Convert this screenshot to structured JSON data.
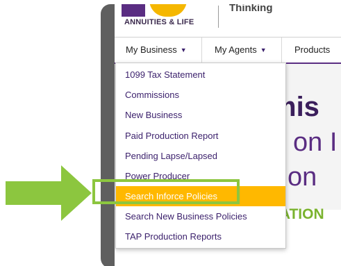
{
  "header": {
    "logo_text": "ANNUITIES & LIFE",
    "tagline": "Thinking"
  },
  "nav": {
    "items": [
      {
        "label": "My Business",
        "caret": "▼"
      },
      {
        "label": "My Agents",
        "caret": "▼"
      },
      {
        "label": "Products",
        "caret": ""
      }
    ]
  },
  "dropdown": {
    "items": [
      {
        "label": "1099 Tax Statement"
      },
      {
        "label": "Commissions"
      },
      {
        "label": "New Business"
      },
      {
        "label": "Paid Production Report"
      },
      {
        "label": "Pending Lapse/Lapsed"
      },
      {
        "label": "Power Producer"
      },
      {
        "label": "Search Inforce Policies",
        "active": true
      },
      {
        "label": "Search New Business Policies"
      },
      {
        "label": "TAP Production Reports"
      }
    ]
  },
  "hero": {
    "line1": "mis",
    "line2": "on I",
    "line3": "tion",
    "line4": "IATION"
  },
  "colors": {
    "brand_purple": "#5a2d82",
    "brand_yellow": "#f5b700",
    "active_item": "#ffb800",
    "highlight_green": "#8cc63f"
  },
  "icons": {
    "callout_arrow": "green-right-arrow-icon",
    "caret": "caret-down-icon"
  }
}
